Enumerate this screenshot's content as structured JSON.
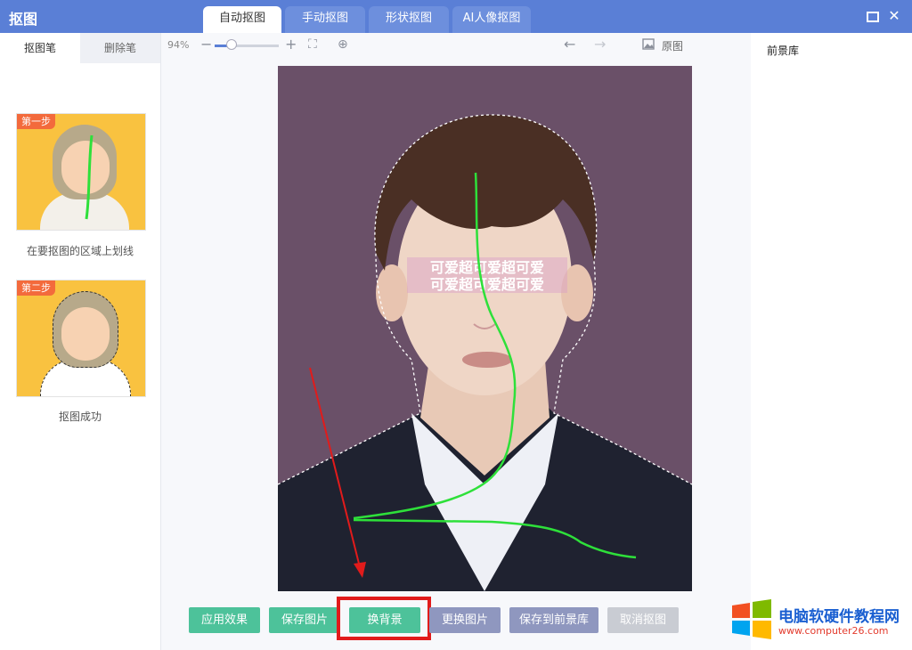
{
  "app": {
    "title": "抠图"
  },
  "tabs": [
    {
      "label": "自动抠图",
      "active": true
    },
    {
      "label": "手动抠图",
      "active": false
    },
    {
      "label": "形状抠图",
      "active": false
    },
    {
      "label": "AI人像抠图",
      "active": false
    }
  ],
  "window": {
    "maximize_icon": "maximize-icon",
    "close_icon": "close-icon",
    "close_glyph": "✕"
  },
  "left_panel": {
    "tabs": [
      {
        "label": "抠图笔",
        "active": true
      },
      {
        "label": "删除笔",
        "active": false
      }
    ],
    "steps": [
      {
        "badge": "第一步",
        "caption": "在要抠图的区域上划线"
      },
      {
        "badge": "第二步",
        "caption": "抠图成功"
      }
    ]
  },
  "toolbar": {
    "zoom": "94%",
    "zoom_out_glyph": "−",
    "zoom_in_glyph": "+",
    "fit_glyph": "⛶",
    "actual_glyph": "⊕",
    "undo_glyph": "←",
    "redo_glyph": "→",
    "original_label": "原图"
  },
  "buttons": {
    "apply": "应用效果",
    "save": "保存图片",
    "change_bg": "换背景",
    "replace_image": "更换图片",
    "save_to_library": "保存到前景库",
    "cancel": "取消抠图"
  },
  "right_panel": {
    "title": "前景库"
  },
  "canvas": {
    "text_overlay_top": "可爱超可爱超可爱",
    "text_overlay_bottom": "可爱超可爱超可爱"
  },
  "watermark": {
    "line1": "电脑软硬件教程网",
    "line2": "www.computer26.com"
  },
  "colors": {
    "title_bar": "#5a7fd6",
    "green_button": "#4dc29a",
    "purple_button": "#8f97bf",
    "highlight": "#e11b1b",
    "stroke": "#2ee03a"
  }
}
